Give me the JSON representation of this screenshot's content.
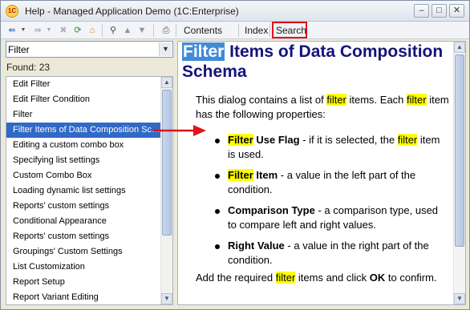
{
  "window": {
    "title": "Help - Managed Application Demo  (1C:Enterprise)",
    "app_icon_text": "1C"
  },
  "toolbar": {
    "contents": "Contents",
    "index": "Index",
    "search": "Search"
  },
  "search": {
    "value": "Filter",
    "found_label": "Found: 23"
  },
  "results": [
    "Edit Filter",
    "Edit Filter Condition",
    "Filter",
    "Filter Items of Data Composition Schema",
    "Editing a custom combo box",
    "Specifying list settings",
    "Custom Combo Box",
    "Loading dynamic list settings",
    "Reports' custom settings",
    "Conditional Appearance",
    "Reports' custom settings",
    "Groupings' Custom Settings",
    "List Customization",
    "Report Setup",
    "Report Variant Editing"
  ],
  "selected_index": 3,
  "topic": {
    "title_highlight": "Filter",
    "title_rest": " Items of Data Composition Schema",
    "intro_1": "This dialog contains a list of ",
    "intro_hl": "filter",
    "intro_2": " items. Each ",
    "intro_hl2": "filter",
    "intro_3": " item has the following properties:",
    "props": [
      {
        "hl": "Filter",
        "name": " Use Flag",
        "desc_1": " - if it is selected, the ",
        "desc_hl": "filter",
        "desc_2": " item is used."
      },
      {
        "hl": "Filter",
        "name": " Item",
        "desc_1": " - a value in the left part of the condition.",
        "desc_hl": "",
        "desc_2": ""
      },
      {
        "hl": "",
        "name": "Comparison Type",
        "desc_1": " - a comparison type, used to compare left and right values.",
        "desc_hl": "",
        "desc_2": ""
      },
      {
        "hl": "",
        "name": "Right Value",
        "desc_1": " - a value in the right part of the condition.",
        "desc_hl": "",
        "desc_2": ""
      }
    ],
    "outro_1": "Add the required ",
    "outro_hl": "filter",
    "outro_2": " items and click ",
    "outro_ok": "OK",
    "outro_3": " to confirm."
  },
  "colors": {
    "highlight": "#ffff00",
    "title": "#14147a",
    "selection": "#3169c6",
    "callout": "#e0131b"
  }
}
